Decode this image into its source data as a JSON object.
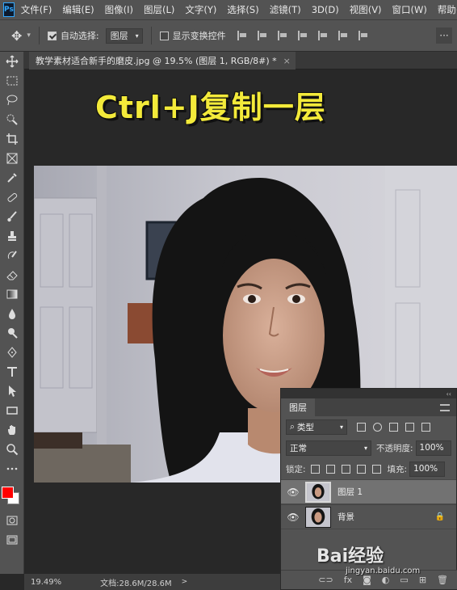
{
  "menubar": {
    "logo": "Ps",
    "items": [
      "文件(F)",
      "编辑(E)",
      "图像(I)",
      "图层(L)",
      "文字(Y)",
      "选择(S)",
      "滤镜(T)",
      "3D(D)",
      "视图(V)",
      "窗口(W)",
      "帮助(H)"
    ]
  },
  "options": {
    "auto_select_label": "自动选择:",
    "auto_select_value": "图层",
    "auto_select_checked": true,
    "transform_label": "显示变换控件",
    "more": "···"
  },
  "document": {
    "tab_title": "教学素材适合新手的磨皮.jpg @ 19.5% (图层 1, RGB/8#) *",
    "close": "×",
    "overlay_text": "Ctrl+J复制一层"
  },
  "statusbar": {
    "zoom": "19.49%",
    "doc": "文档:28.6M/28.6M",
    "arrow": ">"
  },
  "layers_panel": {
    "collapse": "‹‹",
    "tab": "图层",
    "filter_kind": "类型",
    "blend_mode": "正常",
    "opacity_label": "不透明度:",
    "opacity_value": "100%",
    "lock_label": "锁定:",
    "fill_label": "填充:",
    "fill_value": "100%",
    "layers": [
      {
        "name": "图层 1",
        "selected": true,
        "locked": false
      },
      {
        "name": "背景",
        "selected": false,
        "locked": true
      }
    ],
    "bottom_fx": "fx"
  },
  "watermark": {
    "text": "Bai经验",
    "sub": "jingyan.baidu.com"
  },
  "colors": {
    "foreground": "#ff0000",
    "background": "#ffffff",
    "overlay_text": "#f3ea3a"
  }
}
